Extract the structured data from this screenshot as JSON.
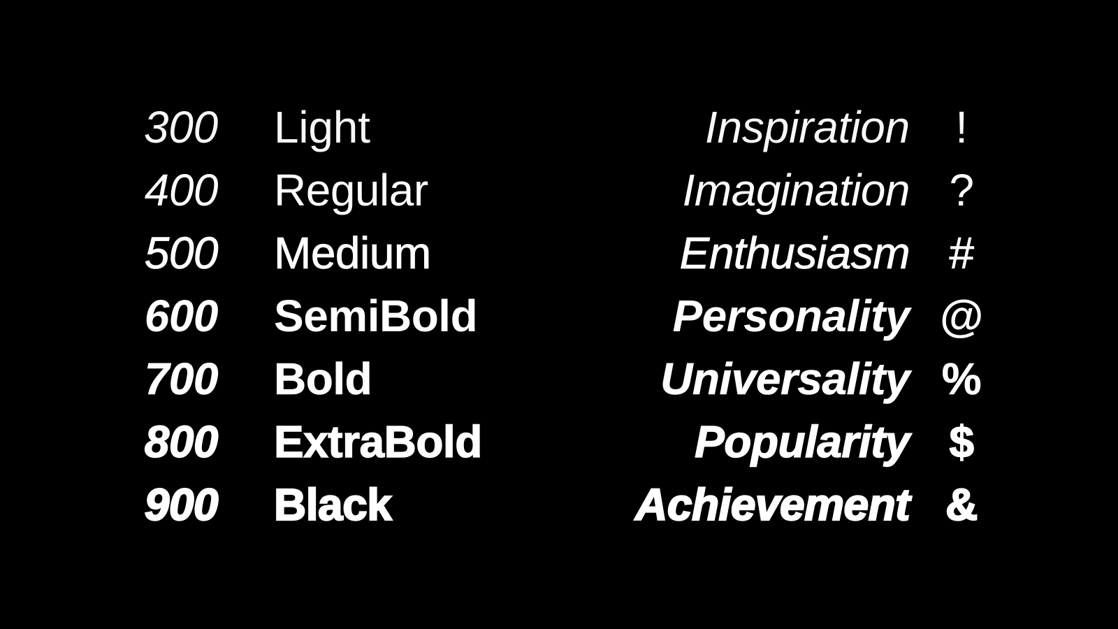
{
  "colors": {
    "background": "#000000",
    "text": "#ffffff"
  },
  "rows": [
    {
      "weight": "300",
      "name": "Light",
      "word": "Inspiration",
      "glyph": "!"
    },
    {
      "weight": "400",
      "name": "Regular",
      "word": "Imagination",
      "glyph": "?"
    },
    {
      "weight": "500",
      "name": "Medium",
      "word": "Enthusiasm",
      "glyph": "#"
    },
    {
      "weight": "600",
      "name": "SemiBold",
      "word": "Personality",
      "glyph": "@"
    },
    {
      "weight": "700",
      "name": "Bold",
      "word": "Universality",
      "glyph": "%"
    },
    {
      "weight": "800",
      "name": "ExtraBold",
      "word": "Popularity",
      "glyph": "$"
    },
    {
      "weight": "900",
      "name": "Black",
      "word": "Achievement",
      "glyph": "&"
    }
  ]
}
